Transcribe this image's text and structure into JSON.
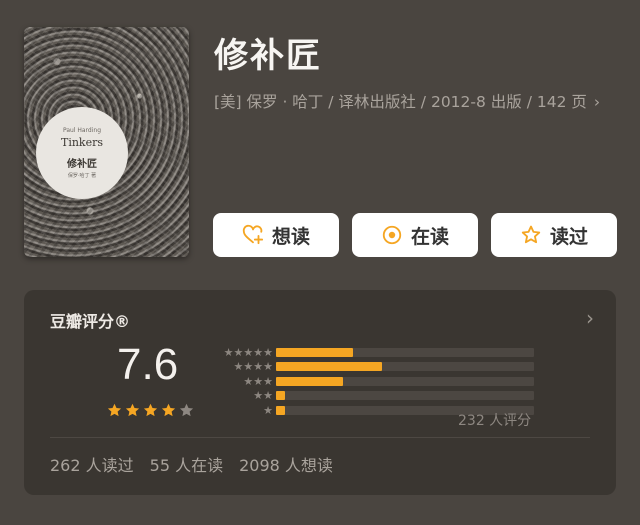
{
  "book": {
    "title": "修补匠",
    "meta": "[美] 保罗 · 哈丁 / 译林出版社 / 2012-8 出版 / 142 页",
    "meta_chevron": "›",
    "cover": {
      "author": "Paul Harding",
      "title_en": "Tinkers",
      "title_cn": "修补匠",
      "subtitle": "保罗·哈丁 著"
    }
  },
  "actions": [
    {
      "label": "想读",
      "icon": "heart-plus-icon"
    },
    {
      "label": "在读",
      "icon": "target-circle-icon"
    },
    {
      "label": "读过",
      "icon": "star-outline-icon"
    }
  ],
  "rating": {
    "title": "豆瓣评分®",
    "chevron": "›",
    "score": "7.6",
    "stars": 4,
    "count_label": "232 人评分",
    "distribution": [
      {
        "stars": 5,
        "fraction": 0.3
      },
      {
        "stars": 4,
        "fraction": 0.41
      },
      {
        "stars": 3,
        "fraction": 0.26
      },
      {
        "stars": 2,
        "fraction": 0.035
      },
      {
        "stars": 1,
        "fraction": 0.035
      }
    ]
  },
  "stats": {
    "read": "262 人读过",
    "reading": "55 人在读",
    "want": "2098 人想读"
  },
  "colors": {
    "background": "#4a4540",
    "card": "#3a3631",
    "accent": "#f5a623",
    "star_empty": "#8d8781"
  }
}
